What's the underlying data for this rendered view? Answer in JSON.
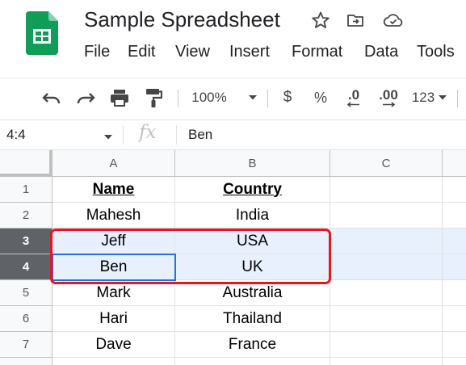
{
  "app": {
    "title": "Sample Spreadsheet",
    "logo_icon": "google-sheets-icon",
    "title_icons": [
      "star-icon",
      "move-to-folder-icon",
      "cloud-saved-icon"
    ],
    "brand_color": "#0f9d58"
  },
  "menu": [
    "File",
    "Edit",
    "View",
    "Insert",
    "Format",
    "Data",
    "Tools"
  ],
  "toolbar": {
    "zoom": "100%",
    "currency": "$",
    "percent": "%",
    "decrease_decimal": ".0",
    "increase_decimal": ".00",
    "more_formats": "123",
    "icons": [
      "undo-icon",
      "redo-icon",
      "print-icon",
      "paint-format-icon"
    ]
  },
  "formula_bar": {
    "name_box": "4:4",
    "fx": "fx",
    "value": "Ben"
  },
  "sheet": {
    "columns": [
      "A",
      "B",
      "C"
    ],
    "rows": [
      {
        "num": "1",
        "a": "Name",
        "b": "Country"
      },
      {
        "num": "2",
        "a": "Mahesh",
        "b": "India"
      },
      {
        "num": "3",
        "a": "Jeff",
        "b": "USA"
      },
      {
        "num": "4",
        "a": "Ben",
        "b": "UK"
      },
      {
        "num": "5",
        "a": "Mark",
        "b": "Australia"
      },
      {
        "num": "6",
        "a": "Hari",
        "b": "Thailand"
      },
      {
        "num": "7",
        "a": "Dave",
        "b": "France"
      }
    ],
    "selected_rows": [
      "3",
      "4"
    ],
    "active_cell": "A4",
    "selection_color": "#e8f0fe",
    "annotation_color": "#e8141e"
  }
}
